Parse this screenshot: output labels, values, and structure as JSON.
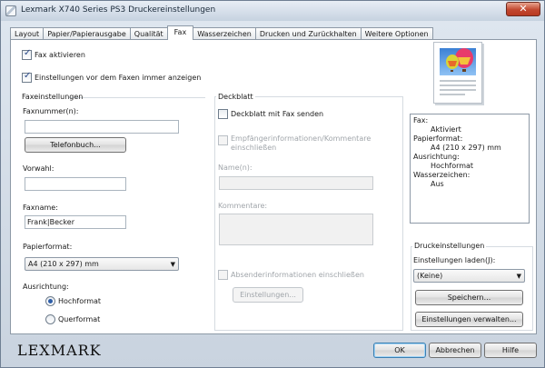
{
  "window": {
    "title": "Lexmark X740 Series PS3 Druckereinstellungen",
    "close_label": "✕"
  },
  "tabs": [
    "Layout",
    "Papier/Papierausgabe",
    "Qualität",
    "Fax",
    "Wasserzeichen",
    "Drucken und Zurückhalten",
    "Weitere Optionen"
  ],
  "active_tab": "Fax",
  "fax": {
    "activate_label": "Fax aktivieren",
    "show_settings_label": "Einstellungen vor dem Faxen immer anzeigen",
    "settings_title": "Faxeinstellungen",
    "number_label": "Faxnummer(n):",
    "number_value": "",
    "phonebook_button": "Telefonbuch...",
    "prefix_label": "Vorwahl:",
    "prefix_value": "",
    "name_label": "Faxname:",
    "name_value": "Frank|Becker",
    "paper_label": "Papierformat:",
    "paper_value": "A4 (210 x 297) mm",
    "orientation_label": "Ausrichtung:",
    "portrait_label": "Hochformat",
    "landscape_label": "Querformat"
  },
  "cover": {
    "title": "Deckblatt",
    "send_label": "Deckblatt mit Fax senden",
    "recipient_info_label": "Empfängerinformationen/Kommentare einschließen",
    "names_label": "Name(n):",
    "comments_label": "Kommentare:",
    "sender_info_label": "Absenderinformationen einschließen",
    "settings_button": "Einstellungen..."
  },
  "summary": [
    {
      "key": "Fax:",
      "value": "Aktiviert"
    },
    {
      "key": "Papierformat:",
      "value": "A4 (210 x 297) mm"
    },
    {
      "key": "Ausrichtung:",
      "value": "Hochformat"
    },
    {
      "key": "Wasserzeichen:",
      "value": "Aus"
    }
  ],
  "print_settings": {
    "title": "Druckeinstellungen",
    "load_label": "Einstellungen laden(J):",
    "load_value": "(Keine)",
    "save_button": "Speichern...",
    "manage_button": "Einstellungen verwalten..."
  },
  "footer": {
    "logo": "LEXMARK",
    "ok": "OK",
    "cancel": "Abbrechen",
    "help": "Hilfe"
  },
  "colors": {
    "accent": "#2e5ea8",
    "titlebar": "#c6d2e0",
    "close": "#c2472f"
  }
}
